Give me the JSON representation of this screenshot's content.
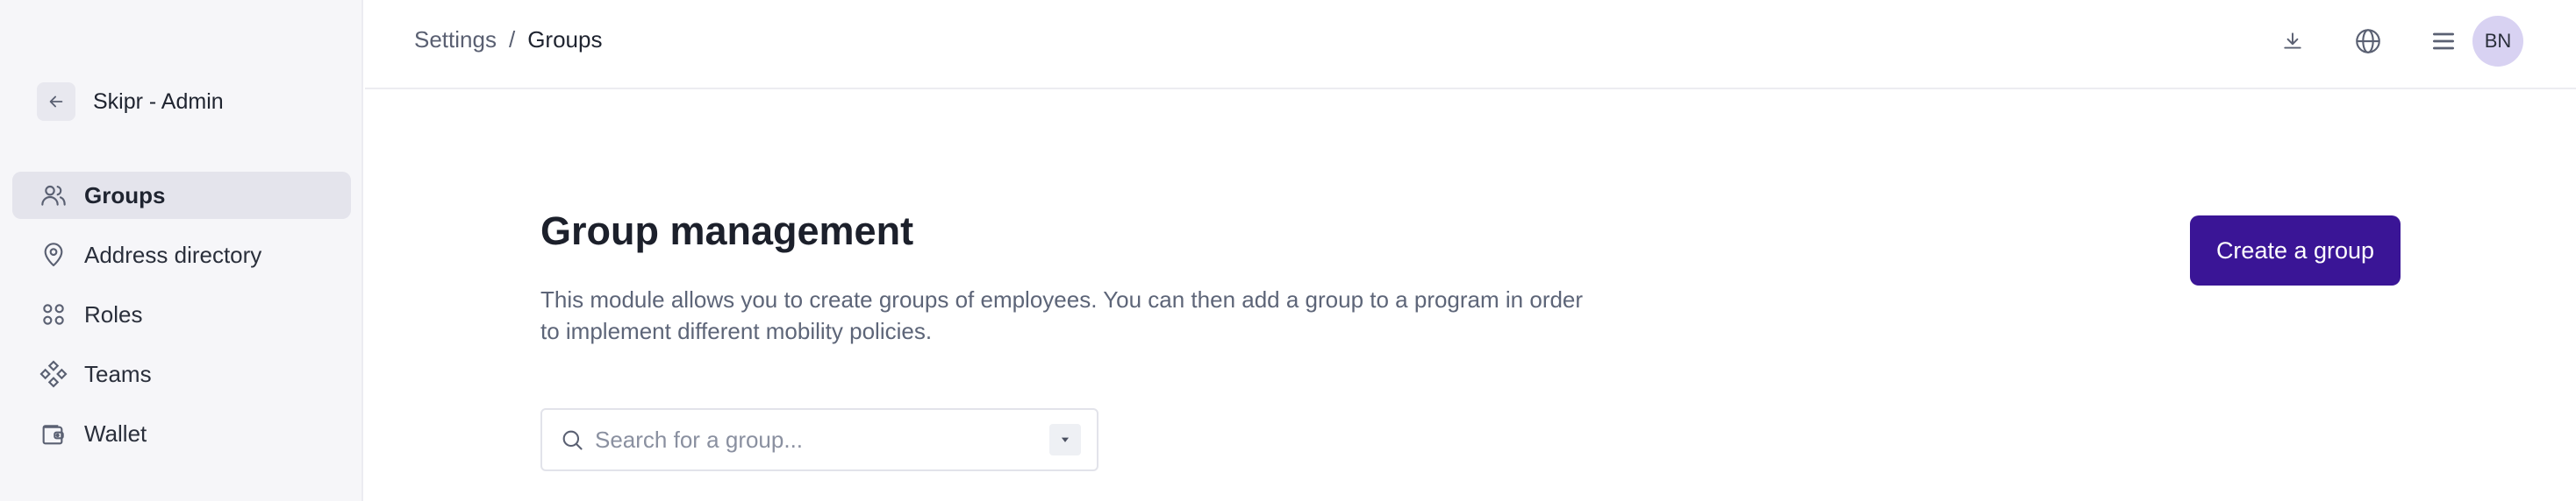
{
  "app": {
    "title": "Skipr - Admin"
  },
  "sidebar": {
    "items": [
      {
        "label": "Groups",
        "icon": "users-icon",
        "active": true
      },
      {
        "label": "Address directory",
        "icon": "map-pin-icon",
        "active": false
      },
      {
        "label": "Roles",
        "icon": "grid-icon",
        "active": false
      },
      {
        "label": "Teams",
        "icon": "teams-icon",
        "active": false
      },
      {
        "label": "Wallet",
        "icon": "wallet-icon",
        "active": false
      }
    ]
  },
  "breadcrumb": {
    "parent": "Settings",
    "separator": "/",
    "current": "Groups"
  },
  "topbar": {
    "icons": [
      "download-icon",
      "globe-icon",
      "menu-icon"
    ],
    "avatar_initials": "BN"
  },
  "main": {
    "title": "Group management",
    "description": "This module allows you to create groups of employees. You can then add a group to a program in order to implement different mobility policies.",
    "create_button": "Create a group",
    "search_placeholder": "Search for a group..."
  },
  "colors": {
    "primary": "#3a1596",
    "sidebar_bg": "#f6f6f9",
    "active_item_bg": "#e4e4ec",
    "avatar_bg": "#d8d2f2"
  }
}
